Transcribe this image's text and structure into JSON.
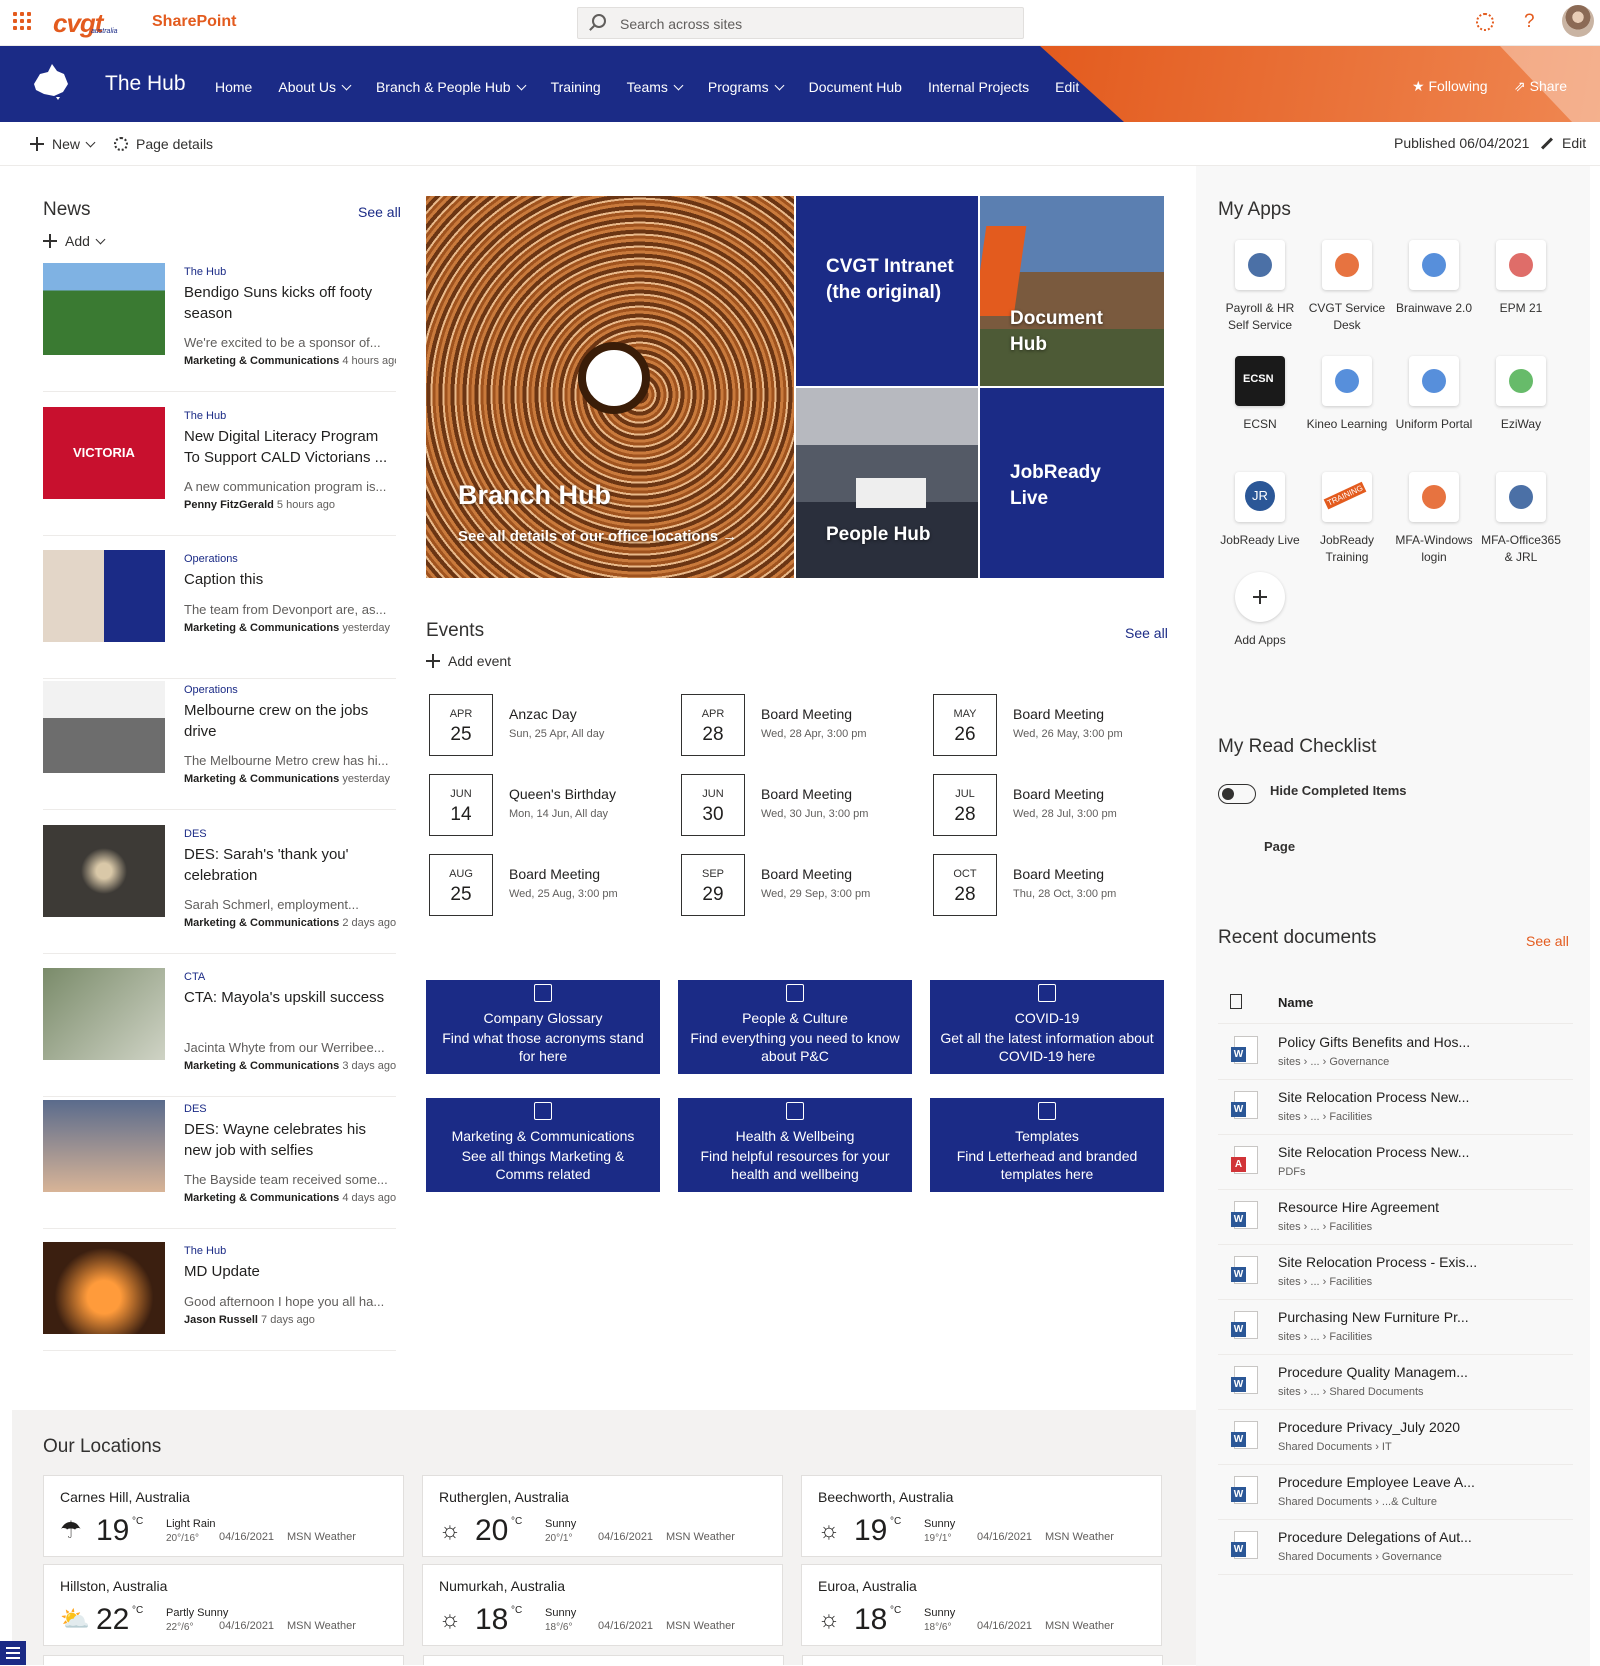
{
  "suite": {
    "brand": "cvgt",
    "brand_sub": "australia",
    "app": "SharePoint",
    "search_placeholder": "Search across sites",
    "colors": {
      "brand_orange": "#e35b1e",
      "brand_navy": "#1b2b86"
    }
  },
  "hub": {
    "title": "The Hub",
    "nav": [
      {
        "label": "Home",
        "menu": false
      },
      {
        "label": "About Us",
        "menu": true
      },
      {
        "label": "Branch & People Hub",
        "menu": true
      },
      {
        "label": "Training",
        "menu": false
      },
      {
        "label": "Teams",
        "menu": true
      },
      {
        "label": "Programs",
        "menu": true
      },
      {
        "label": "Document Hub",
        "menu": false
      },
      {
        "label": "Internal Projects",
        "menu": false
      },
      {
        "label": "Edit",
        "menu": false
      }
    ],
    "following": "Following",
    "share": "Share"
  },
  "cmdbar": {
    "new": "New",
    "page_details": "Page details",
    "published": "Published 06/04/2021",
    "edit": "Edit"
  },
  "news": {
    "title": "News",
    "see_all": "See all",
    "add": "Add",
    "items": [
      {
        "cat": "The Hub",
        "title": "Bendigo Suns kicks off footy season",
        "desc": "We're excited to be a sponsor of...",
        "author": "Marketing & Communications",
        "time": "4 hours ago"
      },
      {
        "cat": "The Hub",
        "title": "New Digital Literacy Program To Support CALD Victorians ...",
        "desc": "A new communication program is...",
        "author": "Penny FitzGerald",
        "time": "5 hours ago"
      },
      {
        "cat": "Operations",
        "title": "Caption this",
        "desc": "The team from Devonport are, as...",
        "author": "Marketing & Communications",
        "time": "yesterday"
      },
      {
        "cat": "Operations",
        "title": "Melbourne crew on the jobs drive",
        "desc": "The Melbourne Metro crew has hi...",
        "author": "Marketing & Communications",
        "time": "yesterday"
      },
      {
        "cat": "DES",
        "title": "DES: Sarah's 'thank you' celebration",
        "desc": "Sarah Schmerl, employment...",
        "author": "Marketing & Communications",
        "time": "2 days ago"
      },
      {
        "cat": "CTA",
        "title": "CTA: Mayola's upskill success",
        "desc": "Jacinta Whyte from our Werribee...",
        "author": "Marketing & Communications",
        "time": "3 days ago"
      },
      {
        "cat": "DES",
        "title": "DES: Wayne celebrates his new job with selfies",
        "desc": "The Bayside team received some...",
        "author": "Marketing & Communications",
        "time": "4 days ago"
      },
      {
        "cat": "The Hub",
        "title": "MD Update",
        "desc": "Good afternoon I hope you all ha...",
        "author": "Jason Russell",
        "time": "7 days ago"
      }
    ],
    "thumb_labels": {
      "victoria": "VICTORIA"
    }
  },
  "hero": {
    "branch": {
      "title": "Branch Hub",
      "link": "See all details of our office locations"
    },
    "intranet": "CVGT Intranet (the original)",
    "document": "Document Hub",
    "people": "People Hub",
    "jobready": "JobReady Live"
  },
  "events": {
    "title": "Events",
    "see_all": "See all",
    "add": "Add event",
    "items": [
      {
        "mon": "APR",
        "day": "25",
        "title": "Anzac Day",
        "when": "Sun, 25 Apr, All day"
      },
      {
        "mon": "APR",
        "day": "28",
        "title": "Board Meeting",
        "when": "Wed, 28 Apr, 3:00 pm"
      },
      {
        "mon": "MAY",
        "day": "26",
        "title": "Board Meeting",
        "when": "Wed, 26 May, 3:00 pm"
      },
      {
        "mon": "JUN",
        "day": "14",
        "title": "Queen's Birthday",
        "when": "Mon, 14 Jun, All day"
      },
      {
        "mon": "JUN",
        "day": "30",
        "title": "Board Meeting",
        "when": "Wed, 30 Jun, 3:00 pm"
      },
      {
        "mon": "JUL",
        "day": "28",
        "title": "Board Meeting",
        "when": "Wed, 28 Jul, 3:00 pm"
      },
      {
        "mon": "AUG",
        "day": "25",
        "title": "Board Meeting",
        "when": "Wed, 25 Aug, 3:00 pm"
      },
      {
        "mon": "SEP",
        "day": "29",
        "title": "Board Meeting",
        "when": "Wed, 29 Sep, 3:00 pm"
      },
      {
        "mon": "OCT",
        "day": "28",
        "title": "Board Meeting",
        "when": "Thu, 28 Oct, 3:00 pm"
      }
    ]
  },
  "quicklinks": [
    {
      "title": "Company Glossary",
      "desc": "Find what those acronyms stand for here",
      "icon": "book-icon"
    },
    {
      "title": "People & Culture",
      "desc": "Find everything you need to know about P&C",
      "icon": "people-icon"
    },
    {
      "title": "COVID-19",
      "desc": "Get all the latest information about COVID-19 here",
      "icon": "qr-icon"
    },
    {
      "title": "Marketing & Communications",
      "desc": "See all things Marketing & Comms related",
      "icon": "image-icon"
    },
    {
      "title": "Health & Wellbeing",
      "desc": "Find helpful resources for your health and wellbeing",
      "icon": "smile-icon"
    },
    {
      "title": "Templates",
      "desc": "Find Letterhead and branded templates here",
      "icon": "templates-icon"
    }
  ],
  "my_apps": {
    "title": "My Apps",
    "items": [
      {
        "label": "Payroll & HR Self Service",
        "color": "#2b5797"
      },
      {
        "label": "CVGT Service Desk",
        "color": "#e35b1e"
      },
      {
        "label": "Brainwave 2.0",
        "color": "#3a7bd5"
      },
      {
        "label": "EPM 21",
        "color": "#d9534f"
      },
      {
        "label": "ECSN",
        "color": "#1a1a1a"
      },
      {
        "label": "Kineo Learning",
        "color": "#3a7bd5"
      },
      {
        "label": "Uniform Portal",
        "color": "#3a7bd5"
      },
      {
        "label": "EziWay",
        "color": "#4caf50"
      },
      {
        "label": "JobReady Live",
        "color": "#2b5797"
      },
      {
        "label": "JobReady Training",
        "color": "#e35b1e"
      },
      {
        "label": "MFA-Windows login",
        "color": "#e35b1e"
      },
      {
        "label": "MFA-Office365 & JRL",
        "color": "#2b5797"
      }
    ],
    "add": "Add Apps",
    "ecsn_text": "ECSN",
    "jr_text": "JR",
    "training_text": "TRAINING"
  },
  "checklist": {
    "title": "My Read Checklist",
    "toggle_label": "Hide Completed Items",
    "col": "Page"
  },
  "recent": {
    "title": "Recent documents",
    "see_all": "See all",
    "col": "Name",
    "items": [
      {
        "name": "Policy Gifts Benefits and Hos...",
        "path": "sites › ... › Governance",
        "type": "word"
      },
      {
        "name": "Site Relocation Process New...",
        "path": "sites › ... › Facilities",
        "type": "word"
      },
      {
        "name": "Site Relocation Process New...",
        "path": "PDFs",
        "type": "pdf"
      },
      {
        "name": "Resource Hire Agreement",
        "path": "sites › ... › Facilities",
        "type": "word"
      },
      {
        "name": "Site Relocation Process - Exis...",
        "path": "sites › ... › Facilities",
        "type": "word"
      },
      {
        "name": "Purchasing New Furniture Pr...",
        "path": "sites › ... › Facilities",
        "type": "word"
      },
      {
        "name": "Procedure Quality Managem...",
        "path": "sites › ... › Shared Documents",
        "type": "word"
      },
      {
        "name": "Procedure Privacy_July 2020",
        "path": "Shared Documents › IT",
        "type": "word"
      },
      {
        "name": "Procedure Employee Leave A...",
        "path": "Shared Documents › ...& Culture",
        "type": "word"
      },
      {
        "name": "Procedure Delegations of Aut...",
        "path": "Shared Documents › Governance",
        "type": "word"
      }
    ],
    "icon_word": "W",
    "icon_pdf": "A"
  },
  "locations": {
    "title": "Our Locations",
    "degree_unit": "°C",
    "items": [
      {
        "city": "Carnes Hill, Australia",
        "temp": "19",
        "cond": "Light Rain",
        "hl": "20°/16°",
        "date": "04/16/2021",
        "src": "MSN Weather",
        "icon": "rain-icon",
        "glyph": "☂"
      },
      {
        "city": "Rutherglen, Australia",
        "temp": "20",
        "cond": "Sunny",
        "hl": "20°/1°",
        "date": "04/16/2021",
        "src": "MSN Weather",
        "icon": "sun-icon",
        "glyph": "☼"
      },
      {
        "city": "Beechworth, Australia",
        "temp": "19",
        "cond": "Sunny",
        "hl": "19°/1°",
        "date": "04/16/2021",
        "src": "MSN Weather",
        "icon": "sun-icon",
        "glyph": "☼"
      },
      {
        "city": "Hillston, Australia",
        "temp": "22",
        "cond": "Partly Sunny",
        "hl": "22°/6°",
        "date": "04/16/2021",
        "src": "MSN Weather",
        "icon": "partly-sunny-icon",
        "glyph": "⛅"
      },
      {
        "city": "Numurkah, Australia",
        "temp": "18",
        "cond": "Sunny",
        "hl": "18°/6°",
        "date": "04/16/2021",
        "src": "MSN Weather",
        "icon": "sun-icon",
        "glyph": "☼"
      },
      {
        "city": "Euroa, Australia",
        "temp": "18",
        "cond": "Sunny",
        "hl": "18°/6°",
        "date": "04/16/2021",
        "src": "MSN Weather",
        "icon": "sun-icon",
        "glyph": "☼"
      }
    ]
  }
}
